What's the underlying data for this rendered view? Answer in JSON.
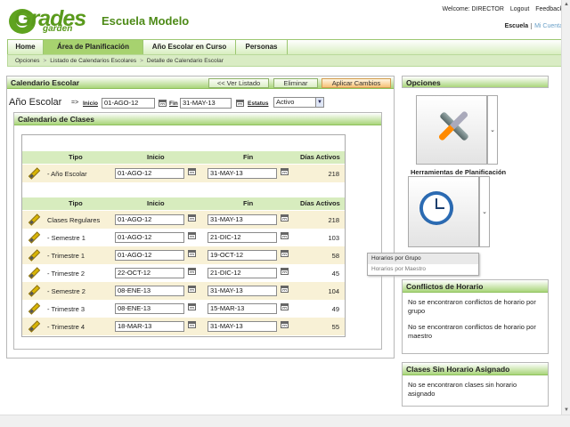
{
  "header": {
    "logo_main": "Grades",
    "logo_sub": "garden",
    "school_name": "Escuela Modelo",
    "welcome": "Welcome: DIRECTOR",
    "logout": "Logout",
    "feedback": "Feedback",
    "link_school": "Escuela",
    "link_account": "Mi Cuenta"
  },
  "tabs": [
    "Home",
    "Área de Planificación",
    "Año Escolar en Curso",
    "Personas"
  ],
  "breadcrumb": [
    "Opciones",
    "Listado de Calendarios Escolares",
    "Detalle de Calendario Escolar"
  ],
  "main_panel": {
    "title": "Calendario Escolar",
    "buttons": {
      "back": "<< Ver Listado",
      "delete": "Eliminar",
      "apply": "Aplicar Cambios"
    },
    "filters": {
      "title": "Año Escolar",
      "arrow": "=>",
      "start_label": "Inicio",
      "start_value": "01-AGO-12",
      "end_label": "Fin",
      "end_value": "31-MAY-13",
      "status_label": "Estatus",
      "status_value": "Activo"
    },
    "classes": {
      "title": "Calendario de Clases",
      "columns": [
        "Tipo",
        "Inicio",
        "Fin",
        "Días Activos"
      ],
      "year_rows": [
        {
          "tipo": "- Año Escolar",
          "inicio": "01-AGO-12",
          "fin": "31-MAY-13",
          "dias": "218"
        }
      ],
      "rows": [
        {
          "tipo": "Clases Regulares",
          "inicio": "01-AGO-12",
          "fin": "31-MAY-13",
          "dias": "218"
        },
        {
          "tipo": "- Semestre 1",
          "inicio": "01-AGO-12",
          "fin": "21-DIC-12",
          "dias": "103"
        },
        {
          "tipo": "- Trimestre 1",
          "inicio": "01-AGO-12",
          "fin": "19-OCT-12",
          "dias": "58"
        },
        {
          "tipo": "- Trimestre 2",
          "inicio": "22-OCT-12",
          "fin": "21-DIC-12",
          "dias": "45"
        },
        {
          "tipo": "- Semestre 2",
          "inicio": "08-ENE-13",
          "fin": "31-MAY-13",
          "dias": "104"
        },
        {
          "tipo": "- Trimestre 3",
          "inicio": "08-ENE-13",
          "fin": "15-MAR-13",
          "dias": "49"
        },
        {
          "tipo": "- Trimestre 4",
          "inicio": "18-MAR-13",
          "fin": "31-MAY-13",
          "dias": "55"
        }
      ]
    }
  },
  "options_panel": {
    "title": "Opciones",
    "tools_label": "Herramientas de Planificación",
    "popup": [
      "Horarios por Grupo",
      "Horarios por Maestro"
    ]
  },
  "conflicts_panel": {
    "title": "Conflictos de Horario",
    "line1": "No se encontraron conflictos de horario por grupo",
    "line2": "No se encontraron conflictos de horario por maestro"
  },
  "unassigned_panel": {
    "title": "Clases Sin Horario Asignado",
    "text": "No se encontraron clases sin horario asignado"
  },
  "colors": {
    "brand_green": "#5a9a1c",
    "header_green": "#a9d57a",
    "alt_row": "#f8f1d6",
    "apply_orange": "#f7c277"
  }
}
